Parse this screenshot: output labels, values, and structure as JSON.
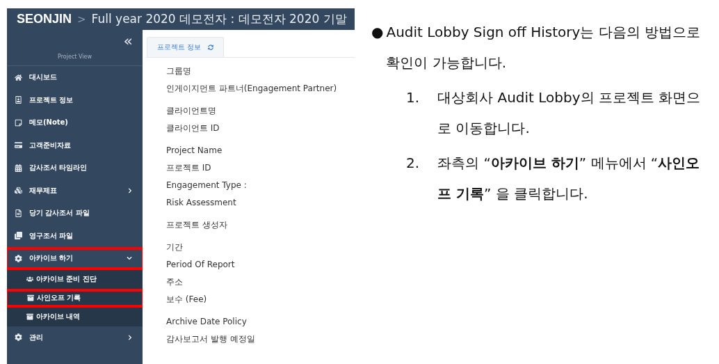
{
  "header": {
    "brand": "SEONJIN",
    "separator": ">",
    "title": "Full year 2020 데모전자 : 데모전자 2020 기말"
  },
  "sidebar": {
    "collapse": "«",
    "caption": "Project View",
    "items": [
      {
        "kind": "item",
        "label": "대시보드",
        "highlighted": false
      },
      {
        "kind": "item",
        "label": "프로젝트 정보",
        "highlighted": false
      },
      {
        "kind": "item",
        "label": "메모(Note)",
        "highlighted": false
      },
      {
        "kind": "item",
        "label": "고객준비자료",
        "highlighted": false
      },
      {
        "kind": "item",
        "label": "감사조서 타임라인",
        "highlighted": false
      },
      {
        "kind": "group",
        "label": "재무제표",
        "expanded": false,
        "highlighted": false
      },
      {
        "kind": "item",
        "label": "당기 감사조서 파일",
        "highlighted": false
      },
      {
        "kind": "item",
        "label": "영구조서 파일",
        "highlighted": false
      },
      {
        "kind": "group",
        "label": "아카이브 하기",
        "expanded": true,
        "highlighted": true,
        "children": [
          {
            "label": "아카이브 준비 진단",
            "highlighted": false
          },
          {
            "label": "사인오프 기록",
            "highlighted": true
          },
          {
            "label": "아카이브 내역",
            "highlighted": false
          }
        ]
      },
      {
        "kind": "group",
        "label": "관리",
        "expanded": false,
        "highlighted": false
      }
    ]
  },
  "tab": {
    "label": "프로젝트 정보",
    "selected": true
  },
  "fields": [
    [
      "그룹명",
      "인게이지먼트 파트너(Engagement Partner)"
    ],
    [
      "클라이언트명",
      "클라이언트 ID"
    ],
    [
      "Project Name",
      "프로젝트 ID",
      "Engagement Type :",
      "Risk Assessment"
    ],
    [
      "프로젝트 생성자"
    ],
    [
      "기간",
      "Period Of Report",
      "주소",
      "보수 (Fee)"
    ],
    [
      "Archive Date Policy",
      "감사보고서 발행 예정일"
    ]
  ],
  "notes": {
    "bullet": "●",
    "text": "Audit Lobby Sign off History는 다음의 방법으로 확인이 가능합니다.",
    "steps": [
      {
        "number": "1.",
        "text": "대상회사 Audit Lobby의 프로젝트 화면으로 이동합니다."
      },
      {
        "number": "2.",
        "text": "좌측의 “**아카이브 하기**” 메뉴에서 “**사인오프 기록**” 을 클릭합니다."
      }
    ]
  }
}
